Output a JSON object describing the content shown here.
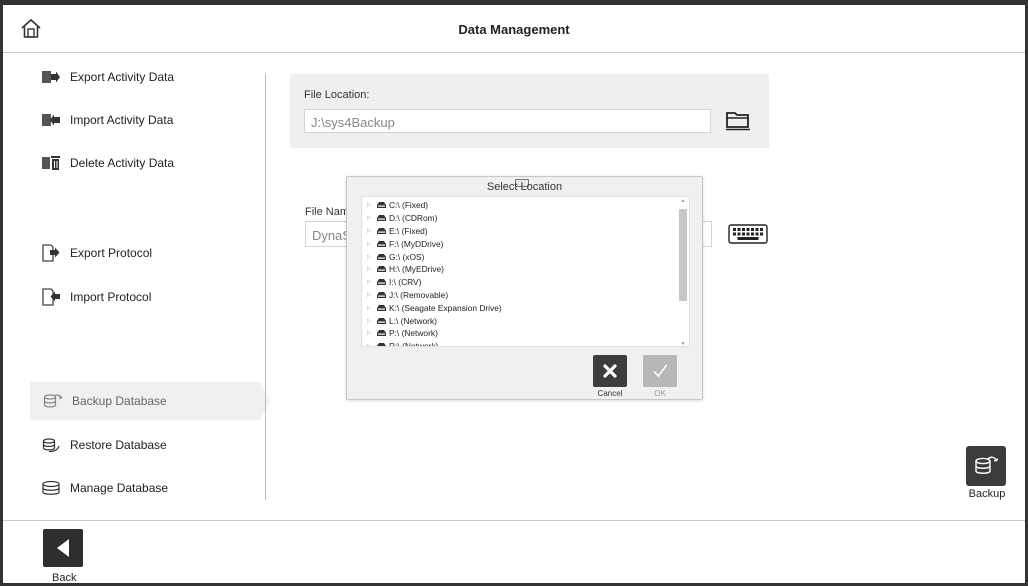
{
  "header": {
    "title": "Data Management"
  },
  "sidebar": {
    "items": [
      {
        "label": "Export Activity Data",
        "icon": "export-icon"
      },
      {
        "label": "Import Activity Data",
        "icon": "import-icon"
      },
      {
        "label": "Delete Activity Data",
        "icon": "trash-icon"
      },
      {
        "label": "Export Protocol",
        "icon": "export-doc-icon"
      },
      {
        "label": "Import Protocol",
        "icon": "import-doc-icon"
      },
      {
        "label": "Backup Database",
        "icon": "database-backup-icon",
        "active": true
      },
      {
        "label": "Restore Database",
        "icon": "database-restore-icon"
      },
      {
        "label": "Manage Database",
        "icon": "database-manage-icon"
      }
    ]
  },
  "main": {
    "file_location_label": "File Location:",
    "file_location_value": "J:\\sys4Backup",
    "file_name_label": "File Nam",
    "file_name_value": "DynaS"
  },
  "dialog": {
    "title": "Select Location",
    "drives": [
      "C:\\ (Fixed)",
      "D:\\ (CDRom)",
      "E:\\ (Fixed)",
      "F:\\ (MyDDrive)",
      "G:\\ (xOS)",
      "H:\\ (MyEDrive)",
      "I:\\ (CRV)",
      "J:\\ (Removable)",
      "K:\\ (Seagate Expansion Drive)",
      "L:\\ (Network)",
      "P:\\ (Network)",
      "R:\\ (Network)"
    ],
    "cancel_label": "Cancel",
    "ok_label": "OK"
  },
  "actions": {
    "backup_label": "Backup"
  },
  "footer": {
    "back_label": "Back"
  },
  "colors": {
    "dark_button": "#3d3d3d",
    "disabled_button": "#b7b7b7",
    "panel_bg": "#efefef"
  }
}
